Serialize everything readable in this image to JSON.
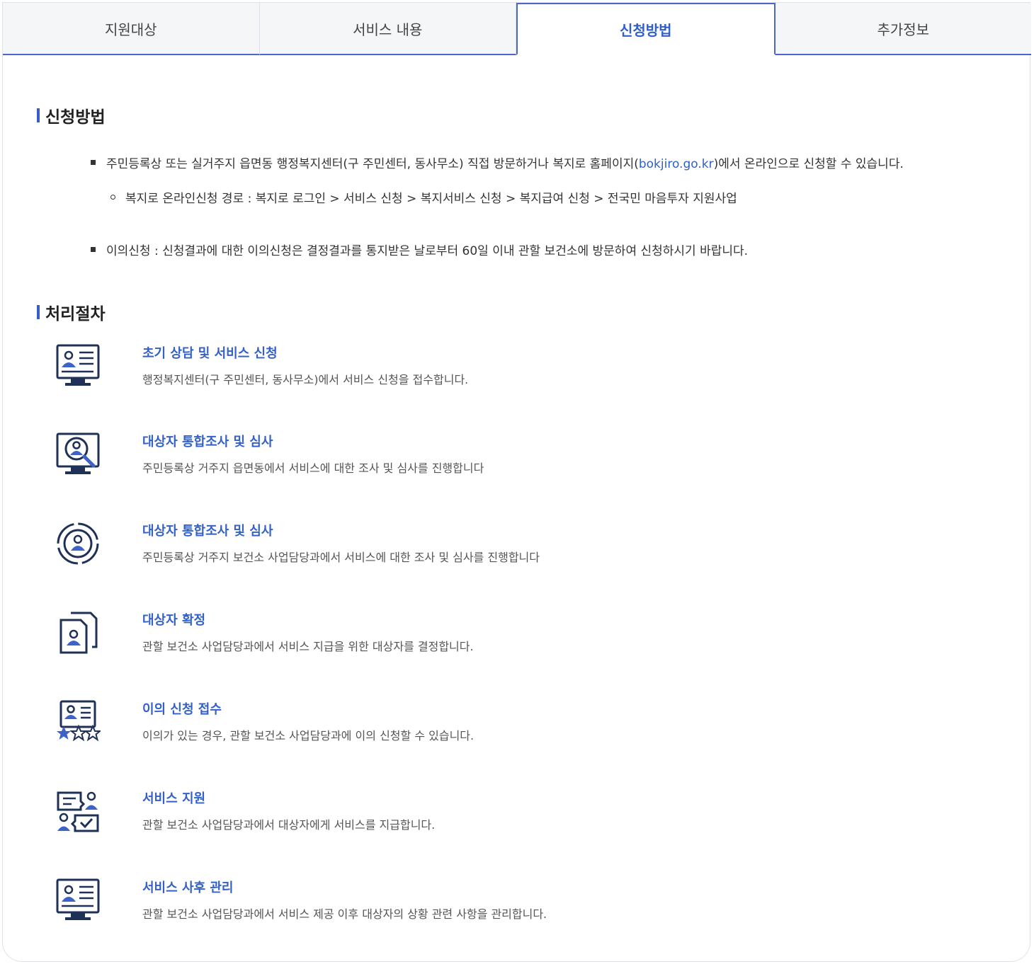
{
  "tabs": [
    {
      "label": "지원대상",
      "active": false
    },
    {
      "label": "서비스 내용",
      "active": false
    },
    {
      "label": "신청방법",
      "active": true
    },
    {
      "label": "추가정보",
      "active": false
    }
  ],
  "apply": {
    "title": "신청방법",
    "bullet1_before": "주민등록상 또는 실거주지 읍면동 행정복지센터(구 주민센터, 동사무소) 직접 방문하거나 복지로 홈페이지(",
    "bullet1_link": "bokjiro.go.kr",
    "bullet1_after": ")에서 온라인으로 신청할 수 있습니다.",
    "sub1": "복지로 온라인신청 경로 : 복지로 로그인 > 서비스 신청 > 복지서비스 신청 > 복지급여 신청 > 전국민 마음투자 지원사업",
    "bullet2": "이의신청 : 신청결과에 대한 이의신청은 결정결과를 통지받은 날로부터 60일 이내 관할 보건소에 방문하여 신청하시기 바랍니다."
  },
  "process": {
    "title": "처리절차",
    "steps": [
      {
        "title": "초기 상담 및 서비스 신청",
        "desc": "행정복지센터(구 주민센터, 동사무소)에서 서비스 신청을 접수합니다.",
        "icon": "monitor-profile-icon"
      },
      {
        "title": "대상자 통합조사 및 심사",
        "desc": "주민등록상 거주지 읍면동에서 서비스에 대한 조사 및 심사를 진행합니다",
        "icon": "monitor-search-person-icon"
      },
      {
        "title": "대상자 통합조사 및 심사",
        "desc": "주민등록상 거주지 보건소 사업담당과에서 서비스에 대한 조사 및 심사를 진행합니다",
        "icon": "target-person-icon"
      },
      {
        "title": "대상자 확정",
        "desc": "관할 보건소 사업담당과에서 서비스 지급을 위한 대상자를 결정합니다.",
        "icon": "documents-person-icon"
      },
      {
        "title": "이의 신청 접수",
        "desc": "이의가 있는 경우, 관할 보건소 사업담당과에 이의 신청할 수 있습니다.",
        "icon": "profile-rating-stars-icon"
      },
      {
        "title": "서비스 지원",
        "desc": "관할 보건소 사업담당과에서 대상자에게 서비스를 지급합니다.",
        "icon": "person-exchange-icon"
      },
      {
        "title": "서비스 사후 관리",
        "desc": "관할 보건소 사업담당과에서 서비스 제공 이후 대상자의 상황 관련 사항을 관리합니다.",
        "icon": "monitor-profile-icon"
      }
    ]
  },
  "colors": {
    "accent": "#3461c8",
    "icon_dark": "#1f3157",
    "icon_blue": "#3e63c8"
  }
}
